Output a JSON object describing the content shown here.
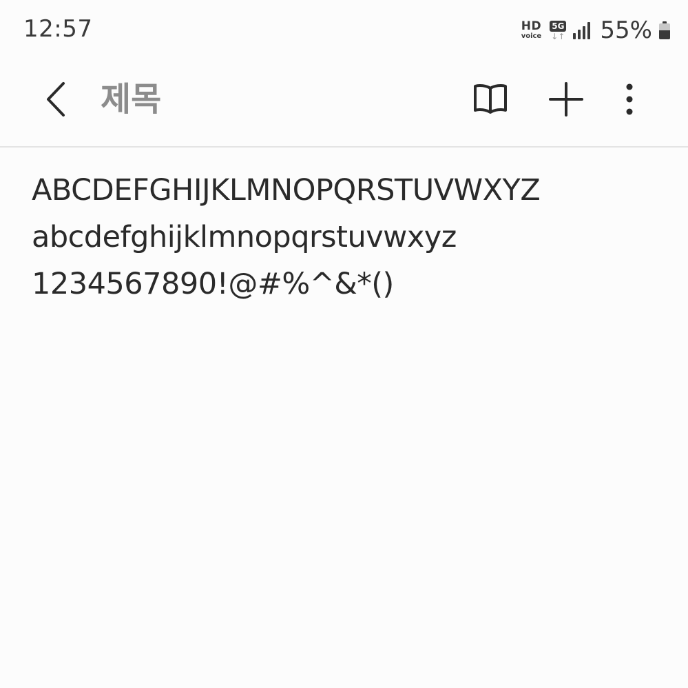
{
  "status_bar": {
    "time": "12:57",
    "hd_label": "HD",
    "voice_label": "voice",
    "network_label": "5G",
    "network_arrows": "↓↑",
    "battery_percent": "55%",
    "battery_level": 0.55,
    "signal_icon": "signal-bars-icon",
    "battery_icon": "battery-icon"
  },
  "toolbar": {
    "back_icon": "back-arrow-icon",
    "title": "제목",
    "reader_icon": "book-open-icon",
    "add_icon": "plus-icon",
    "more_icon": "more-vertical-icon"
  },
  "note": {
    "lines": [
      "ABCDEFGHIJKLMNOPQRSTUVWXYZ",
      "abcdefghijklmnopqrstuvwxyz",
      "1234567890!@#%^&*()"
    ]
  },
  "colors": {
    "background": "#fcfcfc",
    "text": "#2a2a2a",
    "title": "#8c8c8c",
    "divider": "#e4e4e4"
  }
}
